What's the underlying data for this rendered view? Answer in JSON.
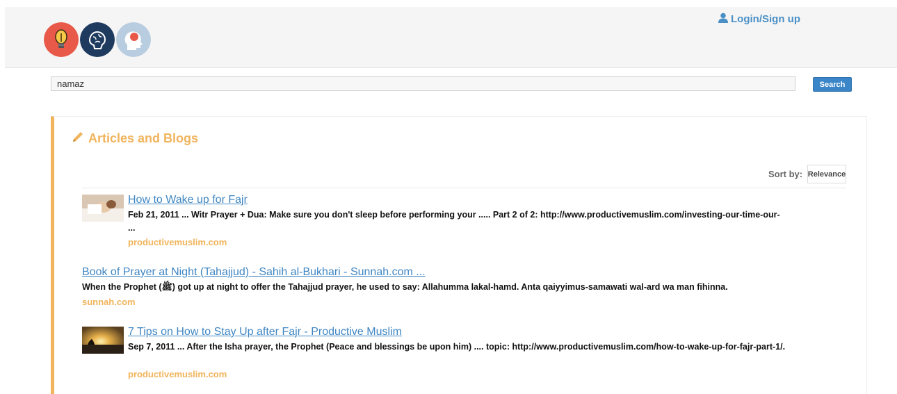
{
  "header": {
    "logos": [
      {
        "icon": "lightbulb-icon",
        "bg": "#e8594a"
      },
      {
        "icon": "brain-icon",
        "bg": "#1f3a5f"
      },
      {
        "icon": "head-icon",
        "bg": "#b8cde0"
      }
    ],
    "login_label": "Login/Sign up"
  },
  "search": {
    "value": "namaz",
    "button_label": "Search"
  },
  "panel": {
    "title": "Articles and Blogs",
    "sort_label": "Sort by:",
    "sort_value": "Relevance",
    "accent": "#f0b45c",
    "results": [
      {
        "title": "How to Wake up for Fajr",
        "snippet": "Feb 21, 2011 ... Witr Prayer + Dua: Make sure you don't sleep before performing your ..... Part 2 of 2: http://www.productivemuslim.com/investing-our-time-our- ...",
        "source": "productivemuslim.com",
        "thumb": "sleeping-person-image"
      },
      {
        "title": "Book of Prayer at Night (Tahajjud) - Sahih al-Bukhari - Sunnah.com ...",
        "snippet": "When the Prophet (ﷺ) got up at night to offer the Tahajjud prayer, he used to say: Allahumma lakal-hamd. Anta qaiyyimus-samawati wal-ard wa man fihinna.",
        "source": "sunnah.com"
      },
      {
        "title": "7 Tips on How to Stay Up after Fajr - Productive Muslim",
        "snippet": "Sep 7, 2011 ... After the Isha prayer, the Prophet (Peace and blessings be upon him) .... topic: http://www.productivemuslim.com/how-to-wake-up-for-fajr-part-1/.",
        "source": "productivemuslim.com",
        "thumb": "sunrise-image"
      }
    ]
  }
}
